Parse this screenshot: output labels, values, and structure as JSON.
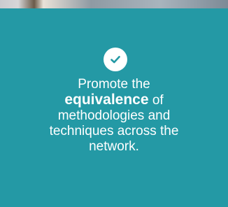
{
  "colors": {
    "card_background": "#2499a5",
    "text": "#ffffff",
    "check_circle": "#ffffff",
    "check_mark": "#2499a5"
  },
  "icon": "check-circle-icon",
  "message": {
    "line1": "Promote the",
    "emphasis": "equivalence",
    "after_emphasis": " of",
    "line3": "methodologies and",
    "line4": "techniques across the",
    "line5": "network."
  }
}
